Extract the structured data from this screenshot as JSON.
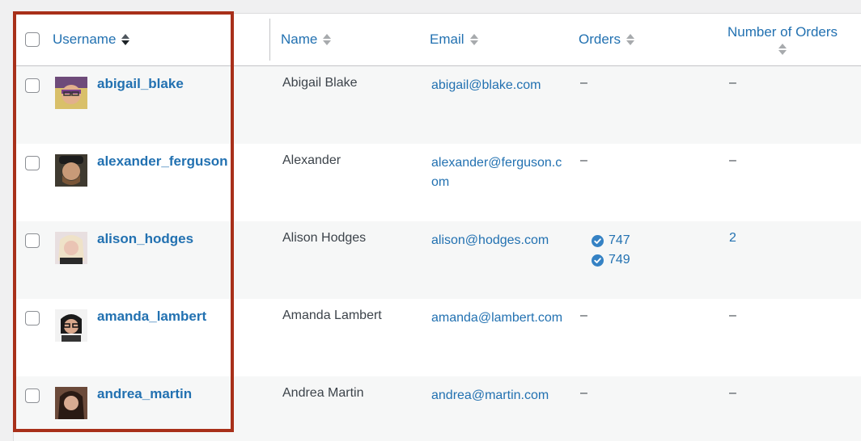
{
  "header": {
    "username": "Username",
    "name": "Name",
    "email": "Email",
    "orders": "Orders",
    "number_of_orders": "Number of Orders"
  },
  "rows": [
    {
      "username": "abigail_blake",
      "name": "Abigail Blake",
      "email": "abigail@blake.com",
      "orders_dash": "–",
      "count": "–"
    },
    {
      "username": "alexander_ferguson",
      "name": "Alexander",
      "email": "alexander@ferguson.com",
      "orders_dash": "–",
      "count": "–"
    },
    {
      "username": "alison_hodges",
      "name": "Alison Hodges",
      "email": "alison@hodges.com",
      "orders": [
        "747",
        "749"
      ],
      "count": "2"
    },
    {
      "username": "amanda_lambert",
      "name": "Amanda Lambert",
      "email": "amanda@lambert.com",
      "orders_dash": "–",
      "count": "–"
    },
    {
      "username": "andrea_martin",
      "name": "Andrea Martin",
      "email": "andrea@martin.com",
      "orders_dash": "–",
      "count": "–"
    }
  ],
  "colors": {
    "link": "#2271b1",
    "highlight": "#a8301a",
    "check": "#3582c4"
  }
}
